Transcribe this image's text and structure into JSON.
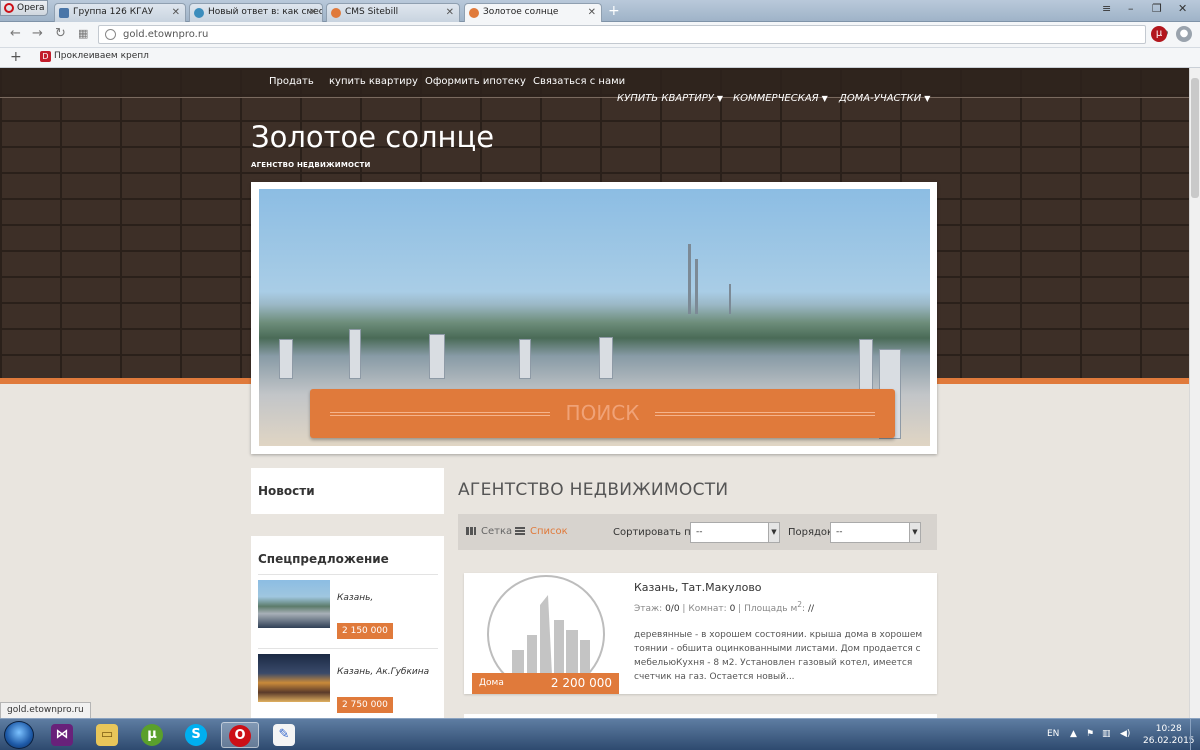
{
  "browser": {
    "menu_label": "Opera",
    "tabs": [
      {
        "label": "Группа 126 КГАУ",
        "icon": "vk-icon",
        "color": "#4a76a8"
      },
      {
        "label": "Новый ответ в: как смести",
        "icon": "forum-icon",
        "color": "#3c8dbc"
      },
      {
        "label": "CMS Sitebill",
        "icon": "sitebill-icon",
        "color": "#e07a3b"
      },
      {
        "label": "Золотое солнце",
        "icon": "sitebill-icon",
        "color": "#e07a3b"
      }
    ],
    "url": "gold.etownpro.ru",
    "bookmark": "Проклеиваем крепл",
    "status_url": "gold.etownpro.ru"
  },
  "site": {
    "topnav": [
      "Продать",
      "купить квартиру",
      "Оформить ипотеку",
      "Связаться с нами"
    ],
    "subnav": [
      "КУПИТЬ КВАРТИРУ",
      "КОММЕРЧЕСКАЯ",
      "ДОМА-УЧАСТКИ"
    ],
    "title": "Золотое солнце",
    "subtitle": "АГЕНСТВО НЕДВИЖИМОСТИ",
    "search_label": "ПОИСК",
    "accent": "#e07a3b"
  },
  "sidebar": {
    "news_title": "Новости",
    "special_title": "Спецпредложение",
    "offers": [
      {
        "location": "Казань,",
        "price": "2 150 000"
      },
      {
        "location": "Казань, Ак.Губкина",
        "price": "2 750 000"
      }
    ]
  },
  "main": {
    "title": "АГЕНТСТВО НЕДВИЖИМОСТИ",
    "view_grid": "Сетка",
    "view_list": "Список",
    "sort_label": "Сортировать по",
    "sort_value": "--",
    "order_label": "Порядок",
    "order_value": "--",
    "listing": {
      "title": "Казань, Тат.Макулово",
      "floor_label": "Этаж:",
      "floor_value": "0/0",
      "rooms_label": "Комнат:",
      "rooms_value": "0",
      "area_label": "Площадь м",
      "area_sup": "2",
      "area_value": "//",
      "description": "деревянные - в хорошем состоянии. крыша дома в хорошем тоянии - обшита оцинкованными листами. Дом продается с мебельюКухня - 8 м2. Установлен газовый котел, имеется счетчик на газ. Остается новый...",
      "type": "Дома",
      "price": "2 200 000"
    }
  },
  "taskbar": {
    "lang": "EN",
    "time": "10:28",
    "date": "26.02.2015"
  }
}
